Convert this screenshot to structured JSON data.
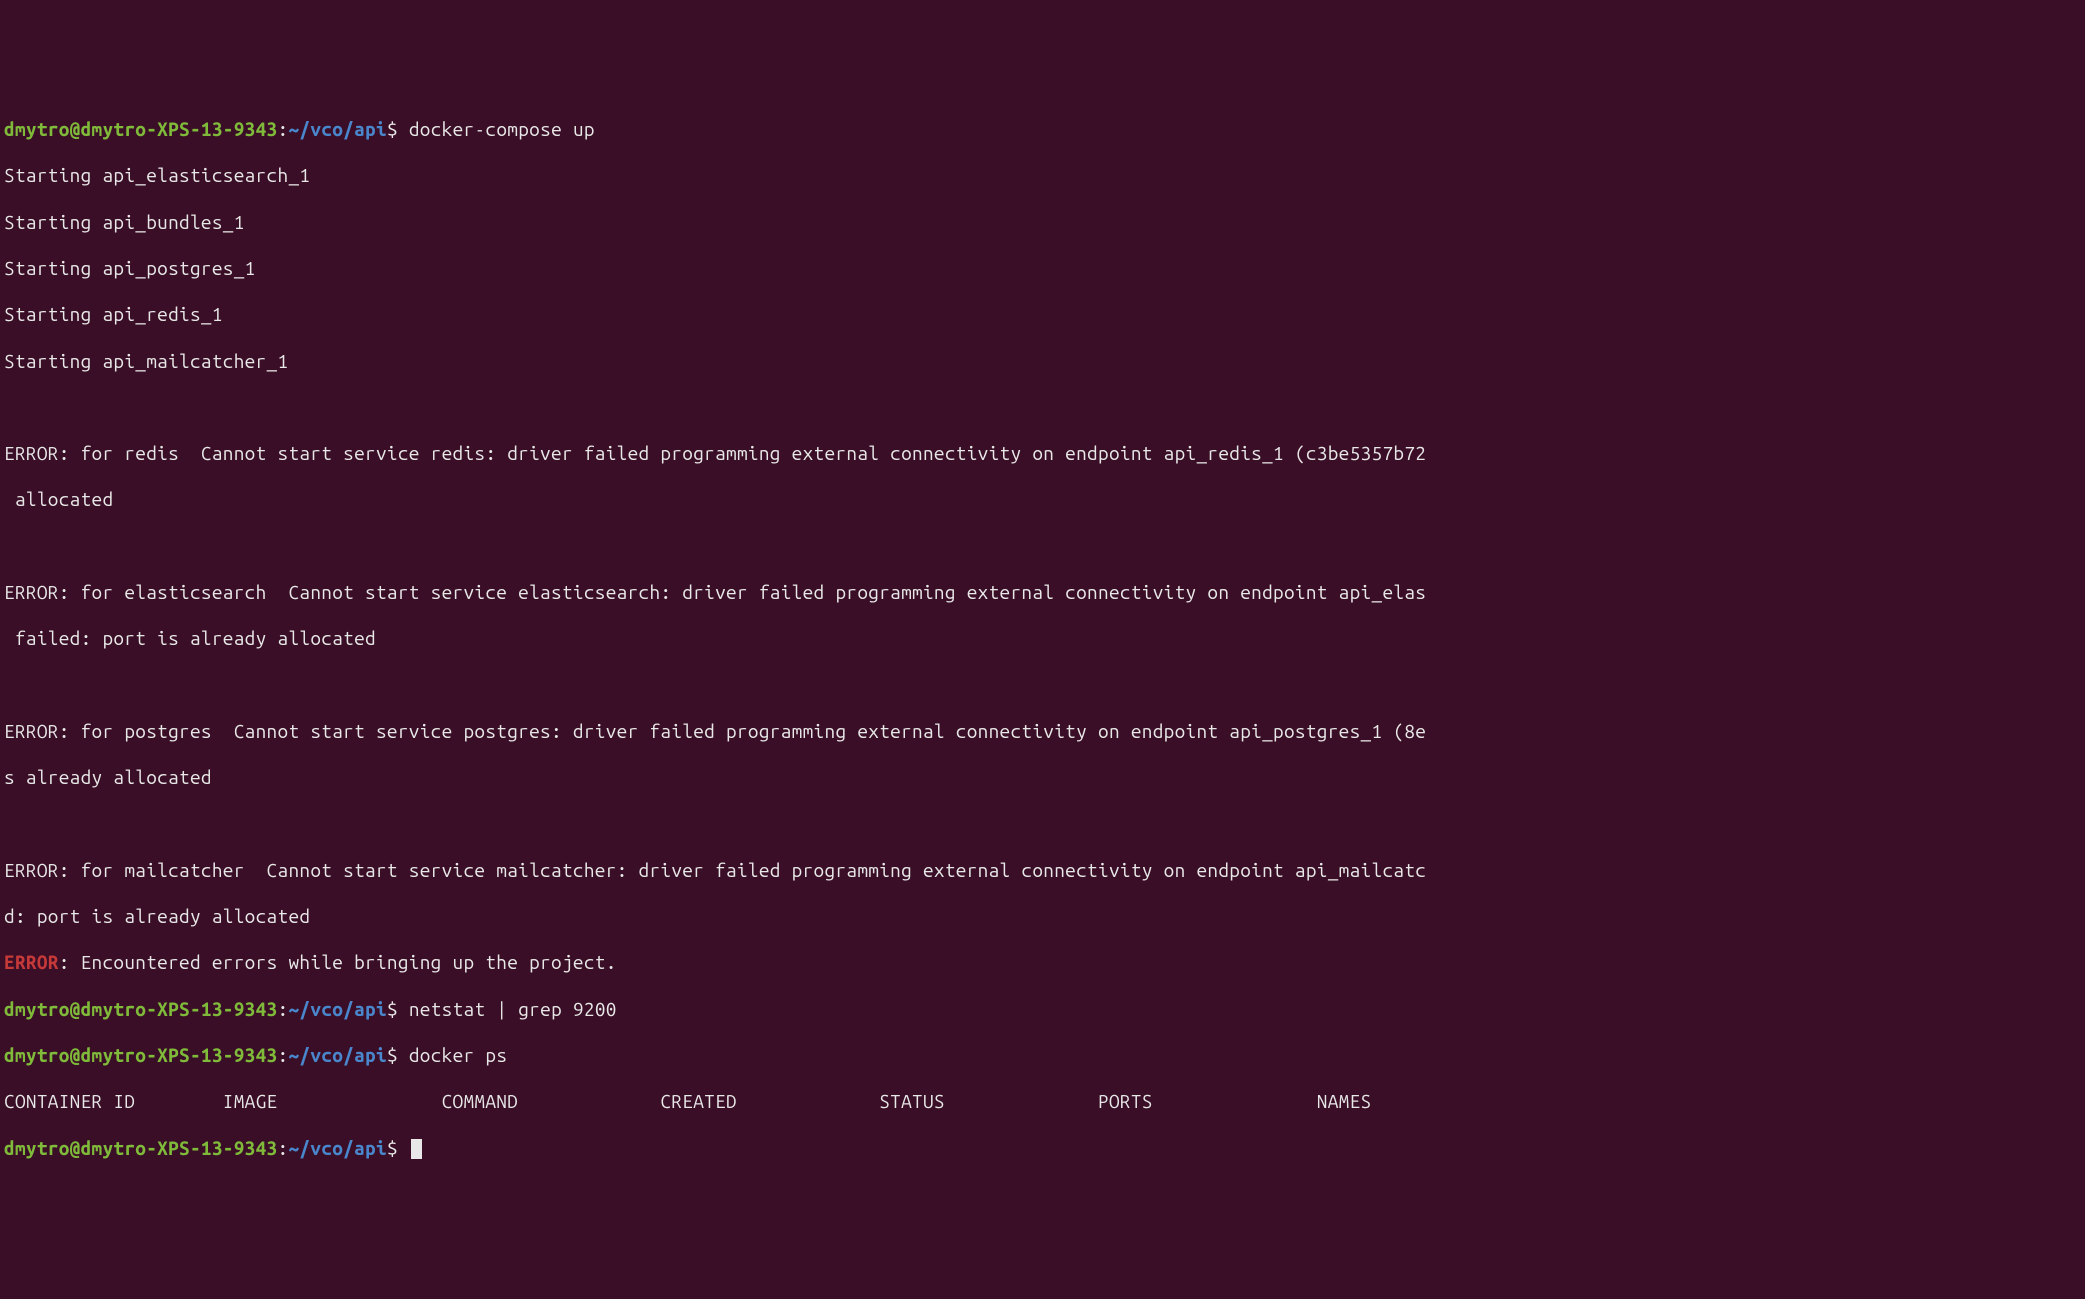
{
  "prompt": {
    "user_host": "dmytro@dmytro-XPS-13-9343",
    "sep1": ":",
    "path": "~/vco/api",
    "sep2": "$"
  },
  "commands": {
    "docker_compose": "docker-compose up",
    "netstat": "netstat | grep 9200",
    "docker_ps": "docker ps"
  },
  "starting": [
    "Starting api_elasticsearch_1",
    "Starting api_bundles_1",
    "Starting api_postgres_1",
    "Starting api_redis_1",
    "Starting api_mailcatcher_1"
  ],
  "errors": {
    "redis_line1": "ERROR: for redis  Cannot start service redis: driver failed programming external connectivity on endpoint api_redis_1 (c3be5357b72",
    "redis_line2": " allocated",
    "elastic_line1": "ERROR: for elasticsearch  Cannot start service elasticsearch: driver failed programming external connectivity on endpoint api_elas",
    "elastic_line2": " failed: port is already allocated",
    "postgres_line1": "ERROR: for postgres  Cannot start service postgres: driver failed programming external connectivity on endpoint api_postgres_1 (8e",
    "postgres_line2": "s already allocated",
    "mailcatcher_line1": "ERROR: for mailcatcher  Cannot start service mailcatcher: driver failed programming external connectivity on endpoint api_mailcatc",
    "mailcatcher_line2": "d: port is already allocated",
    "final_label": "ERROR",
    "final_rest": ": Encountered errors while bringing up the project."
  },
  "docker_ps_header": "CONTAINER ID        IMAGE               COMMAND             CREATED             STATUS              PORTS               NAMES"
}
